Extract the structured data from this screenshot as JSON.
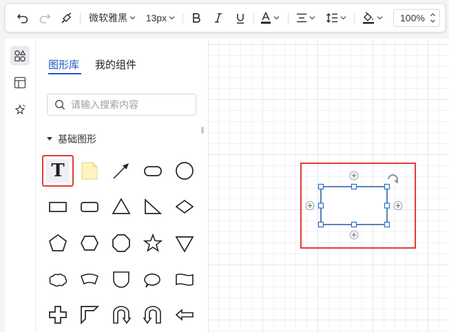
{
  "toolbar": {
    "font_family": "微软雅黑",
    "font_size": "13px",
    "zoom": "100%",
    "icons": [
      "undo-icon",
      "redo-icon",
      "format-painter-icon",
      "bold-icon",
      "italic-icon",
      "underline-icon",
      "font-color-icon",
      "align-icon",
      "line-height-icon",
      "fill-color-icon"
    ]
  },
  "rail": {
    "icons": [
      "shapes-icon",
      "template-icon",
      "magic-icon"
    ]
  },
  "library": {
    "tabs": [
      "图形库",
      "我的组件"
    ],
    "search_placeholder": "请输入搜索内容",
    "section_title": "基础图形",
    "text_tool_glyph": "T",
    "shapes": [
      "text",
      "note",
      "arrow-line",
      "rounded-pill",
      "circle",
      "rectangle",
      "rounded-rectangle",
      "triangle",
      "right-triangle",
      "diamond",
      "pentagon",
      "hexagon",
      "octagon",
      "star",
      "inverted-triangle",
      "cloud",
      "banner",
      "drop",
      "speech-bubble",
      "tape",
      "cross",
      "corner",
      "u-arrow-up",
      "u-arrow-down",
      "left-arrow"
    ]
  },
  "colors": {
    "accent": "#1a57c3",
    "highlight": "#e23b35",
    "handle": "#1f6fd1",
    "shape_stroke": "#2b5797"
  }
}
